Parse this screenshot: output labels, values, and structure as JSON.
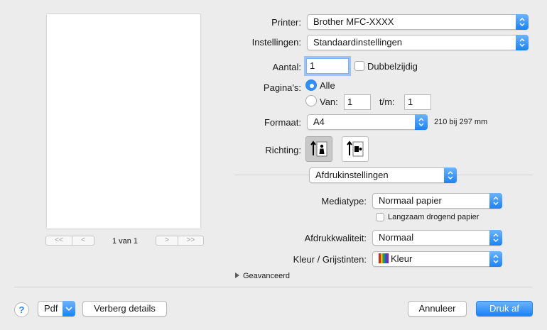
{
  "printer": {
    "label": "Printer:",
    "value": "Brother MFC-XXXX"
  },
  "presets": {
    "label": "Instellingen:",
    "value": "Standaardinstellingen"
  },
  "copies": {
    "label": "Aantal:",
    "value": "1",
    "duplex_label": "Dubbelzijdig"
  },
  "pages": {
    "label": "Pagina's:",
    "all_label": "Alle",
    "from_label": "Van:",
    "from_value": "1",
    "to_label": "t/m:",
    "to_value": "1",
    "selected": "all"
  },
  "paper_size": {
    "label": "Formaat:",
    "value": "A4",
    "dimensions": "210 bij 297 mm"
  },
  "orientation": {
    "label": "Richting:",
    "options": [
      "portrait-icon",
      "landscape-icon"
    ],
    "selected": "portrait"
  },
  "section": {
    "value": "Afdrukinstellingen"
  },
  "media_type": {
    "label": "Mediatype:",
    "value": "Normaal papier",
    "slow_dry_label": "Langzaam drogend papier"
  },
  "quality": {
    "label": "Afdrukkwaliteit:",
    "value": "Normaal"
  },
  "color": {
    "label": "Kleur / Grijstinten:",
    "value": "Kleur"
  },
  "advanced": {
    "label": "Geavanceerd"
  },
  "preview": {
    "page_indicator": "1 van 1",
    "first": "<<",
    "prev": "<",
    "next": ">",
    "last": ">>"
  },
  "bottom": {
    "help": "?",
    "pdf": "Pdf",
    "hide_details": "Verberg details",
    "cancel": "Annuleer",
    "print": "Druk af"
  },
  "colors": {
    "accent": "#1a82fb",
    "background": "#ececec"
  }
}
